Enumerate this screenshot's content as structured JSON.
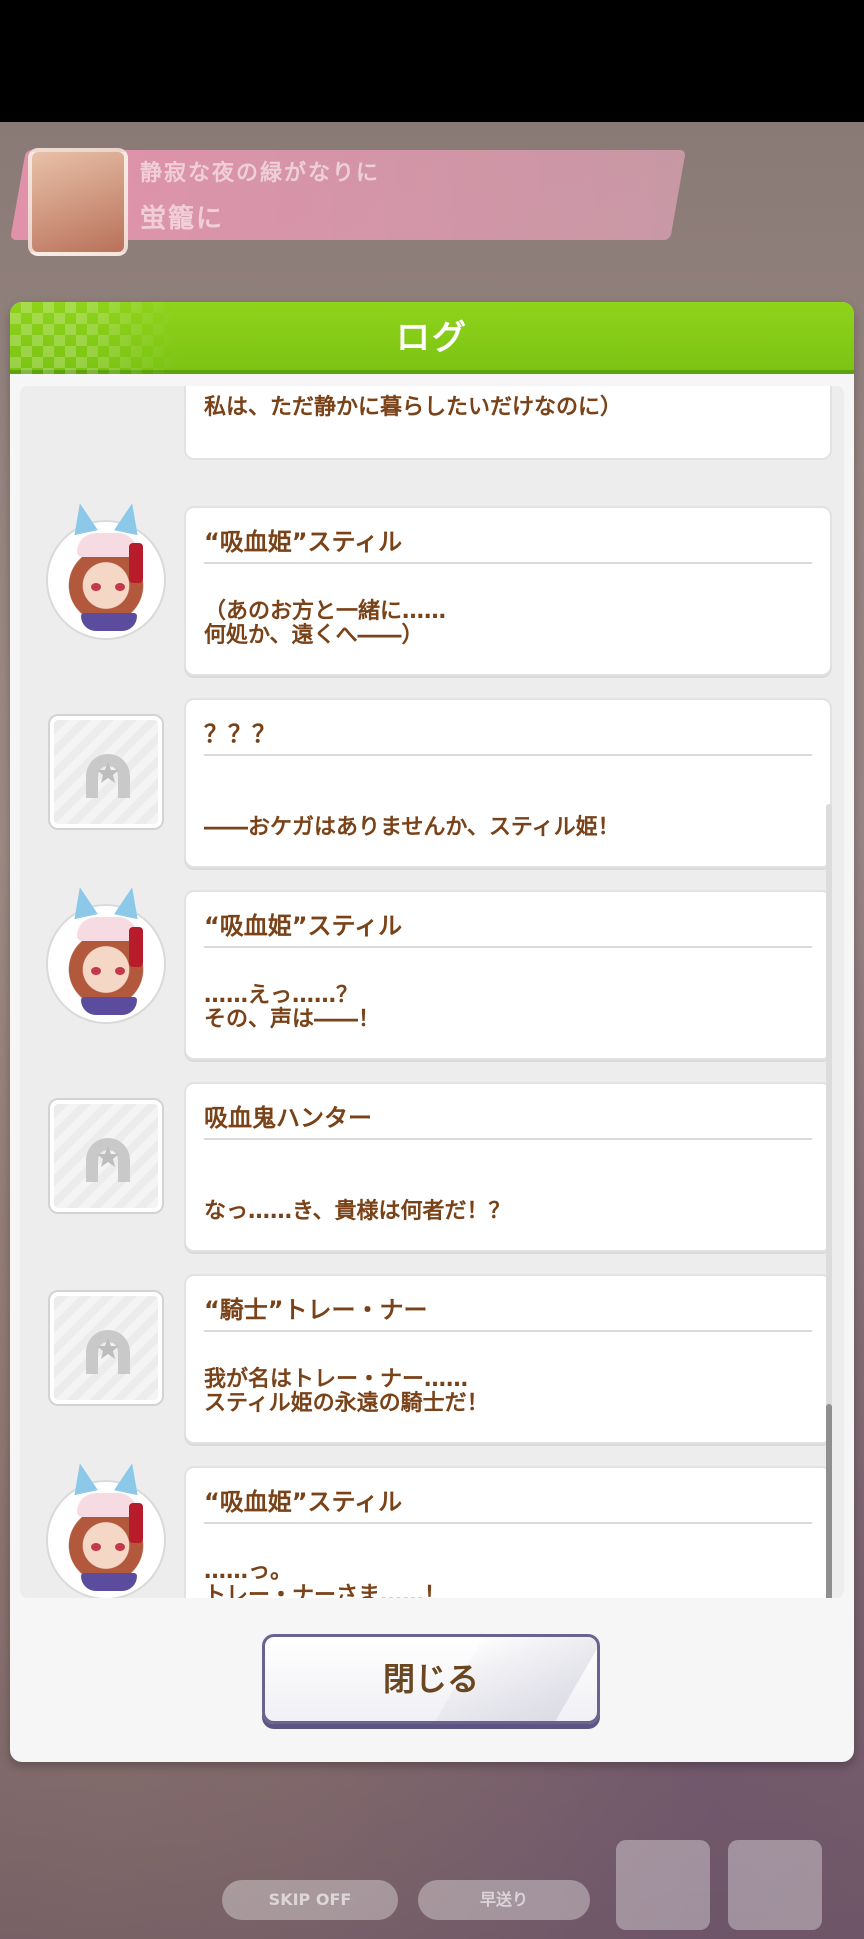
{
  "background": {
    "banner_title": "静寂な夜の緑がなりに",
    "banner_subtitle": "蛍籠に",
    "controls": [
      "SKIP OFF",
      "早送り"
    ]
  },
  "dialog": {
    "title": "ログ",
    "close_label": "閉じる"
  },
  "log": {
    "first_line": "私は、ただ静かに暮らしたいだけなのに）",
    "entries": [
      {
        "speaker": "“吸血姫”スティル",
        "text": "（あのお方と一緒に……\n何処か、遠くへ――）",
        "avatar": "character"
      },
      {
        "speaker": "？？？",
        "text": "――おケガはありませんか、スティル姫！",
        "avatar": "unknown"
      },
      {
        "speaker": "“吸血姫”スティル",
        "text": "……えっ……？\nその、声は――！",
        "avatar": "character"
      },
      {
        "speaker": "吸血鬼ハンター",
        "text": "なっ……き、貴様は何者だ！？",
        "avatar": "unknown"
      },
      {
        "speaker": "“騎士”トレー・ナー",
        "text": "我が名はトレー・ナー……\nスティル姫の永遠の騎士だ！",
        "avatar": "unknown"
      },
      {
        "speaker": "“吸血姫”スティル",
        "text": "……っ。\nトレー・ナーさま……！",
        "avatar": "character"
      }
    ]
  },
  "colors": {
    "header_green": "#7cc414",
    "text_brown": "#7a4218",
    "button_border": "#6b6290"
  }
}
